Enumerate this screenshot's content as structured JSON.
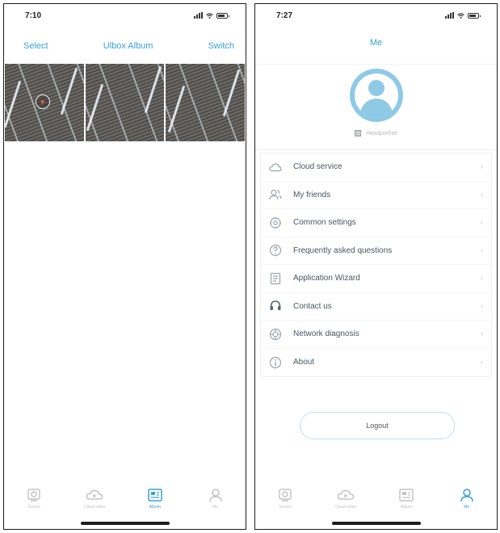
{
  "left_screen": {
    "status_time": "7:10",
    "header": {
      "select_label": "Select",
      "title": "Ulbox Album",
      "switch_label": "Switch"
    },
    "tabs": [
      {
        "label": "Device",
        "icon": "device-icon",
        "active": false
      },
      {
        "label": "Cloud video",
        "icon": "cloud-video-icon",
        "active": false
      },
      {
        "label": "Album",
        "icon": "album-icon",
        "active": true
      },
      {
        "label": "Me",
        "icon": "me-icon",
        "active": false
      }
    ]
  },
  "right_screen": {
    "status_time": "7:27",
    "header": {
      "title": "Me"
    },
    "edit_label": "Headportrait",
    "menu": [
      {
        "label": "Cloud service",
        "icon": "cloud-icon"
      },
      {
        "label": "My friends",
        "icon": "friends-icon"
      },
      {
        "label": "Common settings",
        "icon": "settings-icon"
      },
      {
        "label": "Frequently asked questions",
        "icon": "faq-icon"
      },
      {
        "label": "Application Wizard",
        "icon": "wizard-icon"
      },
      {
        "label": "Contact us",
        "icon": "contact-icon"
      },
      {
        "label": "Network diagnosis",
        "icon": "network-icon"
      },
      {
        "label": "About",
        "icon": "about-icon"
      }
    ],
    "logout_label": "Logout",
    "tabs": [
      {
        "label": "Device",
        "icon": "device-icon",
        "active": false
      },
      {
        "label": "Cloud video",
        "icon": "cloud-video-icon",
        "active": false
      },
      {
        "label": "Album",
        "icon": "album-icon",
        "active": false
      },
      {
        "label": "Me",
        "icon": "me-icon",
        "active": true
      }
    ]
  },
  "colors": {
    "accent": "#3a9fd8",
    "avatar": "#8ecae6",
    "inactive": "#c3c3c3"
  }
}
